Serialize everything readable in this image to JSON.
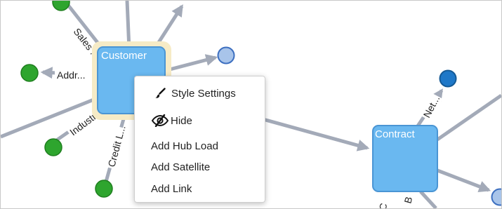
{
  "graph": {
    "hubs": [
      {
        "id": "customer",
        "label": "Customer",
        "selected": true
      },
      {
        "id": "contract",
        "label": "Contract",
        "selected": false
      }
    ],
    "edge_labels": {
      "sales": "Sales ...",
      "addr": "Addr...",
      "industry": "Industr...",
      "credit": "Credit L...",
      "net": "Net...",
      "contract_b": "B",
      "contract_c": "C"
    }
  },
  "context_menu": {
    "items": [
      {
        "id": "style-settings",
        "label": "Style Settings",
        "icon": "paintbrush-icon"
      },
      {
        "id": "hide",
        "label": "Hide",
        "icon": "eye-slash-icon"
      },
      {
        "id": "add-hub-load",
        "label": "Add Hub Load"
      },
      {
        "id": "add-satellite",
        "label": "Add Satellite"
      },
      {
        "id": "add-link",
        "label": "Add Link"
      }
    ]
  },
  "colors": {
    "hub_fill": "#6ab8f0",
    "hub_stroke": "#4a95d4",
    "selection_halo": "#f6ebc6",
    "satellite_green": "#2ea52e",
    "satellite_green_stroke": "#1f7f1f",
    "link_light_blue": "#a8c4ea",
    "link_dark_blue": "#1f78c8",
    "edge_gray": "#a3aab8"
  }
}
